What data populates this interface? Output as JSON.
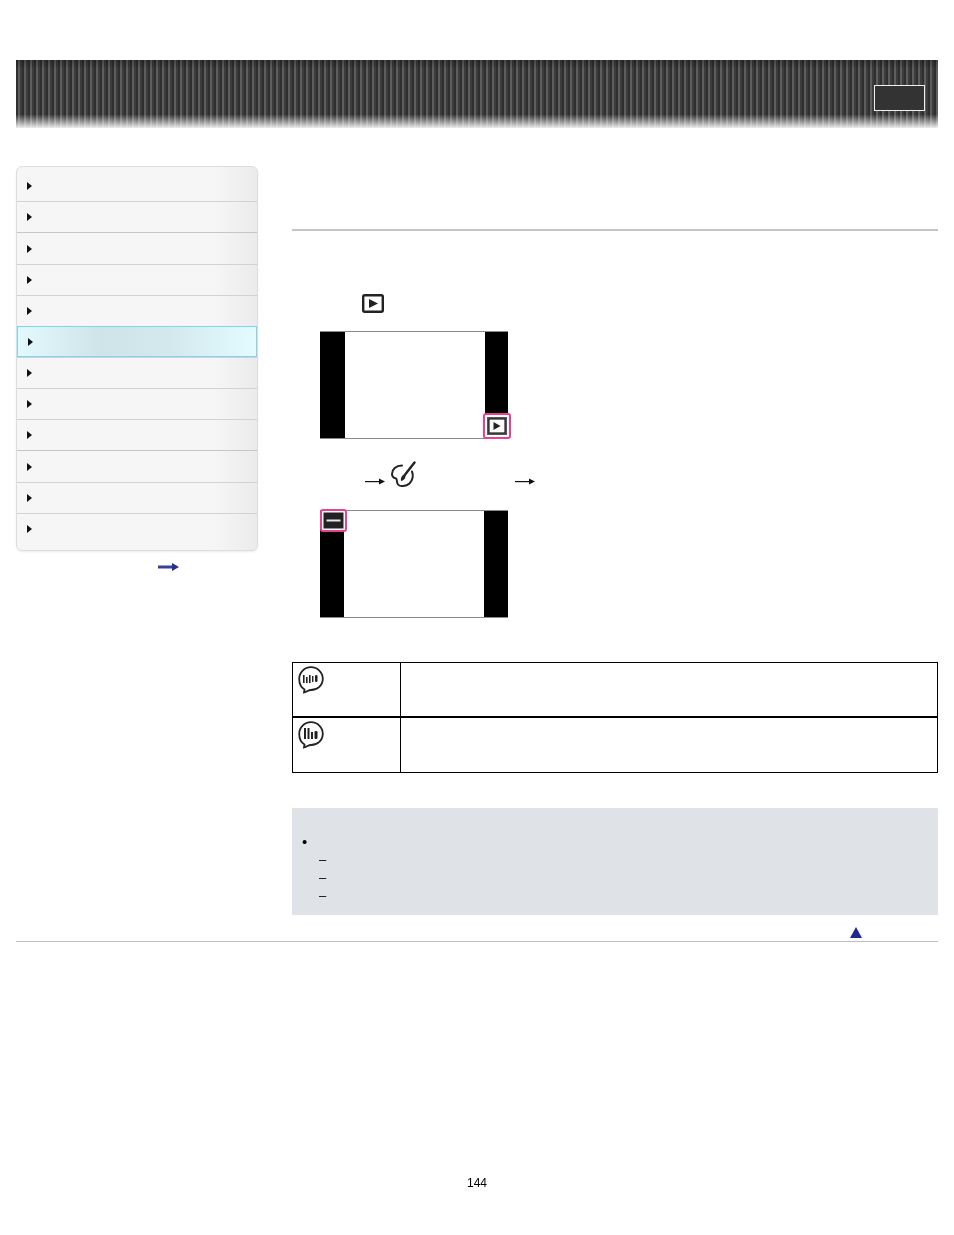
{
  "sidebar": {
    "groups": [
      {
        "items": [
          {
            "selected": false
          },
          {
            "selected": false
          }
        ]
      },
      {
        "items": [
          {
            "selected": false
          },
          {
            "selected": false
          },
          {
            "selected": false
          },
          {
            "selected": true
          },
          {
            "selected": false
          },
          {
            "selected": false
          },
          {
            "selected": false
          }
        ]
      },
      {
        "items": [
          {
            "selected": false
          },
          {
            "selected": false
          },
          {
            "selected": false
          }
        ]
      }
    ]
  },
  "table": {
    "rows": [
      {
        "kind": "watercolor"
      },
      {
        "kind": "illustration"
      }
    ]
  },
  "note": {
    "bullet": "•",
    "dashes": [
      "–",
      "–",
      "–"
    ]
  },
  "page_number": "144"
}
